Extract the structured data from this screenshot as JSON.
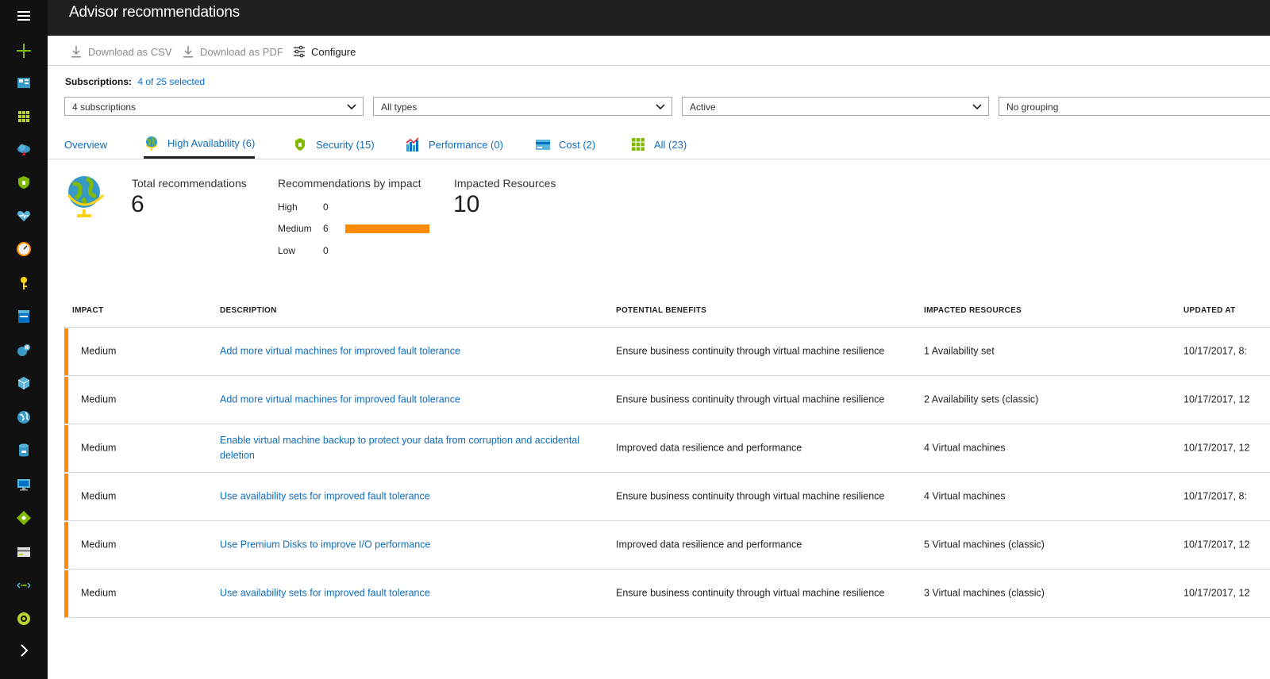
{
  "header": {
    "title": "Advisor recommendations"
  },
  "commands": {
    "download_csv": "Download as CSV",
    "download_pdf": "Download as PDF",
    "configure": "Configure"
  },
  "subscriptions": {
    "label": "Subscriptions:",
    "link": "4 of 25 selected"
  },
  "filters": {
    "subscriptions": "4 subscriptions",
    "type": "All types",
    "status": "Active",
    "grouping": "No grouping"
  },
  "tabs": [
    {
      "label": "Overview",
      "icon": "none"
    },
    {
      "label": "High Availability (6)",
      "icon": "globe-icon"
    },
    {
      "label": "Security (15)",
      "icon": "shield-icon"
    },
    {
      "label": "Performance (0)",
      "icon": "bar-chart-icon"
    },
    {
      "label": "Cost (2)",
      "icon": "credit-card-icon"
    },
    {
      "label": "All (23)",
      "icon": "grid-icon"
    }
  ],
  "summary": {
    "total_label": "Total recommendations",
    "total_value": "6",
    "impact_label": "Recommendations by impact",
    "impact": [
      {
        "level": "High",
        "count": "0",
        "value": 0
      },
      {
        "level": "Medium",
        "count": "6",
        "value": 6
      },
      {
        "level": "Low",
        "count": "0",
        "value": 0
      }
    ],
    "resources_label": "Impacted Resources",
    "resources_value": "10"
  },
  "table": {
    "headers": {
      "impact": "IMPACT",
      "description": "DESCRIPTION",
      "benefits": "POTENTIAL BENEFITS",
      "resources": "IMPACTED RESOURCES",
      "updated": "UPDATED AT"
    },
    "rows": [
      {
        "impact": "Medium",
        "description": "Add more virtual machines for improved fault tolerance",
        "benefits": "Ensure business continuity through virtual machine resilience",
        "resources": "1 Availability set",
        "updated": "10/17/2017, 8:"
      },
      {
        "impact": "Medium",
        "description": "Add more virtual machines for improved fault tolerance",
        "benefits": "Ensure business continuity through virtual machine resilience",
        "resources": "2 Availability sets (classic)",
        "updated": "10/17/2017, 12"
      },
      {
        "impact": "Medium",
        "description": "Enable virtual machine backup to protect your data from corruption and accidental deletion",
        "benefits": "Improved data resilience and performance",
        "resources": "4 Virtual machines",
        "updated": "10/17/2017, 12"
      },
      {
        "impact": "Medium",
        "description": "Use availability sets for improved fault tolerance",
        "benefits": "Ensure business continuity through virtual machine resilience",
        "resources": "4 Virtual machines",
        "updated": "10/17/2017, 8:"
      },
      {
        "impact": "Medium",
        "description": "Use Premium Disks to improve I/O performance",
        "benefits": "Improved data resilience and performance",
        "resources": "5 Virtual machines (classic)",
        "updated": "10/17/2017, 12"
      },
      {
        "impact": "Medium",
        "description": "Use availability sets for improved fault tolerance",
        "benefits": "Ensure business continuity through virtual machine resilience",
        "resources": "3 Virtual machines (classic)",
        "updated": "10/17/2017, 12"
      }
    ]
  },
  "sidebar": {
    "icons": [
      "hamburger-icon",
      "plus-icon",
      "dashboard-icon",
      "all-resources-icon",
      "cloud-icon",
      "security-center-icon",
      "monitor-heart-icon",
      "advisor-gauge-icon",
      "key-icon",
      "storage-icon",
      "app-service-icon",
      "cube-icon",
      "globe-icon",
      "sql-database-icon",
      "virtual-machine-icon",
      "load-balancer-icon",
      "cost-icon",
      "network-icon",
      "circle-icon",
      "chevron-right-icon"
    ]
  },
  "colors": {
    "accent": "#ff8c00",
    "link": "#0f6cbd",
    "topbar": "#1f1f1f",
    "rail": "#111111"
  }
}
